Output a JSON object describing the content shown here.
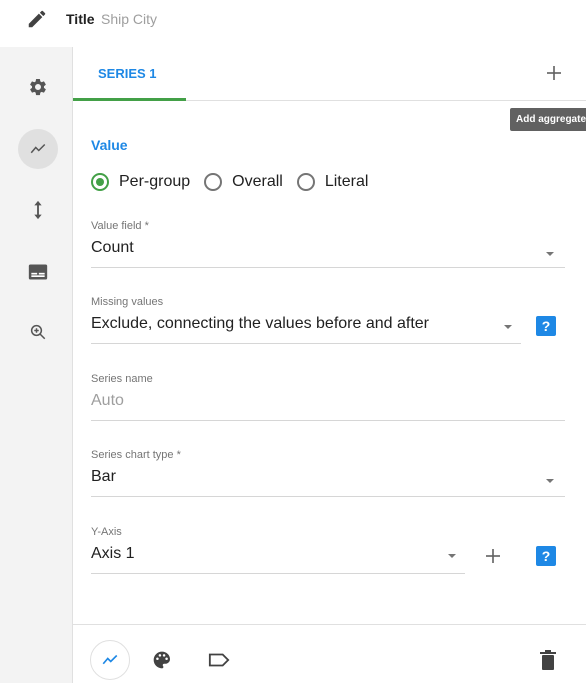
{
  "header": {
    "title_label": "Title",
    "title_value": "Ship City"
  },
  "sidebar": {
    "items": [
      "gear-icon",
      "line-chart-icon",
      "vertical-arrows-icon",
      "caption-icon",
      "zoom-in-icon"
    ],
    "active": "line-chart-icon"
  },
  "tabs": {
    "series_label": "SERIES 1",
    "add_label": "+"
  },
  "tooltip": {
    "text": "Add aggregate"
  },
  "value_section": {
    "title": "Value",
    "options": [
      "Per-group",
      "Overall",
      "Literal"
    ],
    "selected": "Per-group"
  },
  "fields": {
    "value_field": {
      "label": "Value field *",
      "value": "Count"
    },
    "missing_values": {
      "label": "Missing values",
      "value": "Exclude, connecting the values before and after"
    },
    "series_name": {
      "label": "Series name",
      "value": "Auto"
    },
    "series_chart_type": {
      "label": "Series chart type *",
      "value": "Bar"
    },
    "y_axis": {
      "label": "Y-Axis",
      "value": "Axis 1"
    }
  },
  "help_glyph": "?",
  "colors": {
    "accent_blue": "#1e88e5",
    "accent_green": "#43a047"
  }
}
